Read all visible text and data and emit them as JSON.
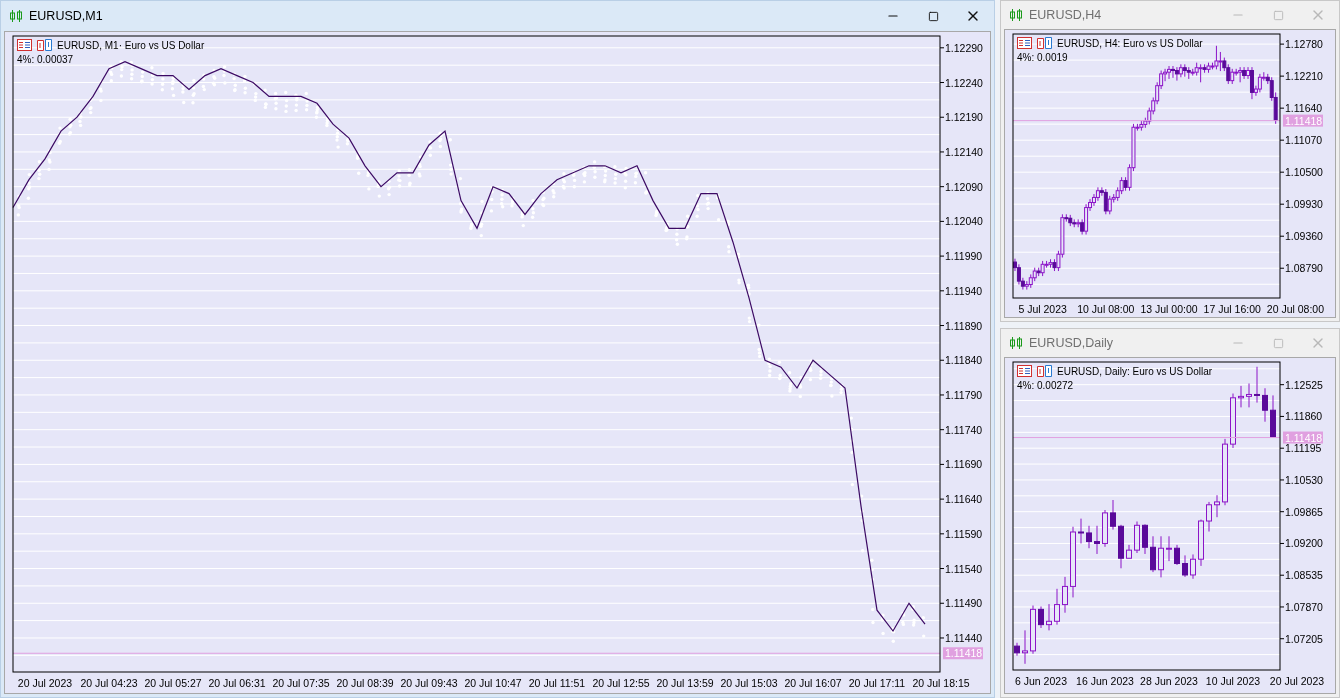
{
  "windows": [
    {
      "title": "EURUSD,M1",
      "active": true,
      "chart": {
        "symbol_label": "EURUSD, M1· Euro vs US Dollar",
        "scale_label": "4%: 0.00037",
        "chart_data": {
          "type": "line",
          "grid": true,
          "ylim": [
            1.11391,
            1.12307
          ],
          "categories": [
            null,
            null,
            "20 Jul 2023",
            null,
            null,
            null,
            "20 Jul 04:23",
            null,
            null,
            null,
            "20 Jul 05:27",
            null,
            null,
            null,
            "20 Jul 06:31",
            null,
            null,
            null,
            "20 Jul 07:35",
            null,
            null,
            null,
            "20 Jul 08:39",
            null,
            null,
            null,
            "20 Jul 09:43",
            null,
            null,
            null,
            "20 Jul 10:47",
            null,
            null,
            null,
            "20 Jul 11:51",
            null,
            null,
            null,
            "20 Jul 12:55",
            null,
            null,
            null,
            "20 Jul 13:59",
            null,
            null,
            null,
            "20 Jul 15:03",
            null,
            null,
            null,
            "20 Jul 16:07",
            null,
            null,
            null,
            "20 Jul 17:11",
            null,
            null,
            null,
            "20 Jul 18:15"
          ],
          "yticks": [
            {
              "value": 1.1229,
              "label": "1.12290"
            },
            {
              "value": 1.1224,
              "label": "1.12240"
            },
            {
              "value": 1.1219,
              "label": "1.12190"
            },
            {
              "value": 1.1214,
              "label": "1.12140"
            },
            {
              "value": 1.1209,
              "label": "1.12090"
            },
            {
              "value": 1.1204,
              "label": "1.12040"
            },
            {
              "value": 1.1199,
              "label": "1.11990"
            },
            {
              "value": 1.1194,
              "label": "1.11940"
            },
            {
              "value": 1.1189,
              "label": "1.11890"
            },
            {
              "value": 1.1184,
              "label": "1.11840"
            },
            {
              "value": 1.1179,
              "label": "1.11790"
            },
            {
              "value": 1.1174,
              "label": "1.11740"
            },
            {
              "value": 1.1169,
              "label": "1.11690"
            },
            {
              "value": 1.1164,
              "label": "1.11640"
            },
            {
              "value": 1.1159,
              "label": "1.11590"
            },
            {
              "value": 1.1154,
              "label": "1.11540"
            },
            {
              "value": 1.1149,
              "label": "1.11490"
            },
            {
              "value": 1.1144,
              "label": "1.11440"
            }
          ],
          "ref_lines": [
            {
              "axis": "y",
              "value": 1.11418,
              "label": "1.11418"
            }
          ],
          "series": [
            {
              "color": "#3c0a64",
              "values": [
                1.1206,
                1.121,
                1.1213,
                1.1217,
                1.1219,
                1.1222,
                1.1226,
                1.1227,
                1.1226,
                1.1225,
                1.1225,
                1.1223,
                1.1225,
                1.1226,
                1.1225,
                1.1224,
                1.1222,
                1.1222,
                1.1222,
                1.1221,
                1.1218,
                1.1216,
                1.1212,
                1.1209,
                1.1211,
                1.1211,
                1.1215,
                1.1217,
                1.1207,
                1.1203,
                1.1209,
                1.1208,
                1.1205,
                1.1208,
                1.121,
                1.1211,
                1.1212,
                1.1212,
                1.1211,
                1.1212,
                1.1207,
                1.1203,
                1.1203,
                1.1208,
                1.1208,
                1.1201,
                1.1193,
                1.1184,
                1.1183,
                1.118,
                1.1184,
                1.1182,
                1.118,
                1.1163,
                1.1148,
                1.1145,
                1.1149,
                1.1146,
                null
              ]
            }
          ]
        }
      }
    },
    {
      "title": "EURUSD,H4",
      "active": false,
      "chart": {
        "symbol_label": "EURUSD, H4:  Euro vs US Dollar",
        "scale_label": "4%: 0.0019",
        "chart_data": {
          "type": "candlestick",
          "grid": true,
          "ylim": [
            1.0826,
            1.1296
          ],
          "categories": [
            null,
            null,
            null,
            null,
            null,
            null,
            null,
            "5 Jul 2023",
            null,
            null,
            null,
            null,
            null,
            null,
            null,
            null,
            null,
            null,
            null,
            null,
            null,
            null,
            null,
            "10 Jul 08:00",
            null,
            null,
            null,
            null,
            null,
            null,
            null,
            null,
            null,
            null,
            null,
            null,
            null,
            null,
            null,
            "13 Jul 00:00",
            null,
            null,
            null,
            null,
            null,
            null,
            null,
            null,
            null,
            null,
            null,
            null,
            null,
            null,
            null,
            "17 Jul 16:00",
            null,
            null,
            null,
            null,
            null,
            null,
            null,
            null,
            null,
            null,
            null,
            null,
            null,
            null,
            null,
            "20 Jul 08:00"
          ],
          "yticks": [
            {
              "value": 1.1278,
              "label": "1.12780"
            },
            {
              "value": 1.1221,
              "label": "1.12210"
            },
            {
              "value": 1.1164,
              "label": "1.11640"
            },
            {
              "value": 1.1107,
              "label": "1.11070"
            },
            {
              "value": 1.105,
              "label": "1.10500"
            },
            {
              "value": 1.0993,
              "label": "1.09930"
            },
            {
              "value": 1.0936,
              "label": "1.09360"
            },
            {
              "value": 1.0879,
              "label": "1.08790"
            }
          ],
          "ref_lines": [
            {
              "axis": "y",
              "value": 1.11418,
              "label": "1.11418"
            }
          ],
          "ohlc": [
            [
              1.089,
              1.0896,
              1.0874,
              1.088
            ],
            [
              1.088,
              1.0886,
              1.085,
              1.0856
            ],
            [
              1.0856,
              1.0862,
              1.0841,
              1.0847
            ],
            [
              1.0847,
              1.0856,
              1.0841,
              1.085
            ],
            [
              1.085,
              1.0868,
              1.0844,
              1.0862
            ],
            [
              1.0862,
              1.088,
              1.0856,
              1.0874
            ],
            [
              1.0874,
              1.088,
              1.0865,
              1.0871
            ],
            [
              1.0871,
              1.0892,
              1.0865,
              1.0886
            ],
            [
              1.0886,
              1.0892,
              1.088,
              1.0886
            ],
            [
              1.0886,
              1.0895,
              1.088,
              1.0889
            ],
            [
              1.0889,
              1.0895,
              1.0874,
              1.088
            ],
            [
              1.088,
              1.091,
              1.0874,
              1.0904
            ],
            [
              1.0904,
              1.0975,
              1.0898,
              1.0969
            ],
            [
              1.0969,
              1.0975,
              1.0962,
              1.0968
            ],
            [
              1.0968,
              1.0974,
              1.0954,
              1.096
            ],
            [
              1.096,
              1.0966,
              1.0952,
              1.0958
            ],
            [
              1.0958,
              1.0966,
              1.0952,
              1.096
            ],
            [
              1.096,
              1.0966,
              1.0939,
              1.0945
            ],
            [
              1.0945,
              1.0993,
              1.0939,
              1.0987
            ],
            [
              1.0987,
              1.1002,
              1.0981,
              1.0996
            ],
            [
              1.0996,
              1.1011,
              1.099,
              1.1005
            ],
            [
              1.1005,
              1.1023,
              1.0999,
              1.1017
            ],
            [
              1.1017,
              1.1023,
              1.1008,
              1.1014
            ],
            [
              1.1014,
              1.102,
              1.0975,
              1.0981
            ],
            [
              1.0981,
              1.1008,
              1.0975,
              1.1002
            ],
            [
              1.1002,
              1.1011,
              1.0996,
              1.1005
            ],
            [
              1.1005,
              1.1023,
              1.0999,
              1.1017
            ],
            [
              1.1017,
              1.1041,
              1.1011,
              1.1035
            ],
            [
              1.1035,
              1.1041,
              1.1017,
              1.1023
            ],
            [
              1.1023,
              1.1064,
              1.1017,
              1.1058
            ],
            [
              1.1058,
              1.1136,
              1.1052,
              1.113
            ],
            [
              1.113,
              1.1136,
              1.1124,
              1.113
            ],
            [
              1.113,
              1.1141,
              1.1124,
              1.1135
            ],
            [
              1.1135,
              1.1147,
              1.1129,
              1.1141
            ],
            [
              1.1141,
              1.1165,
              1.1135,
              1.1159
            ],
            [
              1.1159,
              1.1183,
              1.1153,
              1.1177
            ],
            [
              1.1177,
              1.121,
              1.1171,
              1.1204
            ],
            [
              1.1204,
              1.1231,
              1.1198,
              1.1225
            ],
            [
              1.1225,
              1.1234,
              1.1212,
              1.1228
            ],
            [
              1.1228,
              1.1239,
              1.1216,
              1.1233
            ],
            [
              1.1233,
              1.1239,
              1.1218,
              1.1231
            ],
            [
              1.1231,
              1.1237,
              1.1213,
              1.1225
            ],
            [
              1.1225,
              1.1242,
              1.1219,
              1.1236
            ],
            [
              1.1236,
              1.1242,
              1.122,
              1.1231
            ],
            [
              1.1231,
              1.1237,
              1.1216,
              1.1228
            ],
            [
              1.1228,
              1.1234,
              1.1222,
              1.1228
            ],
            [
              1.1228,
              1.1245,
              1.1222,
              1.1236
            ],
            [
              1.1236,
              1.1242,
              1.121,
              1.1236
            ],
            [
              1.1236,
              1.1242,
              1.1227,
              1.1233
            ],
            [
              1.1233,
              1.1245,
              1.1227,
              1.1239
            ],
            [
              1.1239,
              1.1245,
              1.1233,
              1.1239
            ],
            [
              1.1239,
              1.1275,
              1.1233,
              1.1248
            ],
            [
              1.1248,
              1.1264,
              1.123,
              1.1248
            ],
            [
              1.1248,
              1.1254,
              1.123,
              1.1236
            ],
            [
              1.1236,
              1.1242,
              1.1207,
              1.1213
            ],
            [
              1.1213,
              1.1234,
              1.1207,
              1.1228
            ],
            [
              1.1228,
              1.1234,
              1.1222,
              1.1228
            ],
            [
              1.1228,
              1.1237,
              1.121,
              1.1231
            ],
            [
              1.1231,
              1.1237,
              1.1216,
              1.1222
            ],
            [
              1.1222,
              1.1237,
              1.1216,
              1.1231
            ],
            [
              1.1231,
              1.1237,
              1.118,
              1.1192
            ],
            [
              1.1192,
              1.1204,
              1.1186,
              1.1198
            ],
            [
              1.1198,
              1.1225,
              1.1192,
              1.1219
            ],
            [
              1.1219,
              1.1228,
              1.1213,
              1.1219
            ],
            [
              1.1219,
              1.1225,
              1.1207,
              1.1213
            ],
            [
              1.1213,
              1.1219,
              1.1177,
              1.1183
            ],
            [
              1.1183,
              1.1192,
              1.1136,
              1.1142
            ],
            null,
            null,
            null,
            null,
            null
          ]
        }
      }
    },
    {
      "title": "EURUSD,Daily",
      "active": false,
      "chart": {
        "symbol_label": "EURUSD, Daily:  Euro vs US Dollar",
        "scale_label": "4%: 0.00272",
        "chart_data": {
          "type": "candlestick",
          "grid": true,
          "ylim": [
            1.0655,
            1.13
          ],
          "categories": [
            null,
            null,
            null,
            "6 Jun 2023",
            null,
            null,
            null,
            null,
            null,
            null,
            null,
            "16 Jun 2023",
            null,
            null,
            null,
            null,
            null,
            null,
            null,
            "28 Jun 2023",
            null,
            null,
            null,
            null,
            null,
            null,
            null,
            "10 Jul 2023",
            null,
            null,
            null,
            null,
            null,
            null,
            null,
            "20 Jul 2023"
          ],
          "yticks": [
            {
              "value": 1.12525,
              "label": "1.12525"
            },
            {
              "value": 1.1186,
              "label": "1.11860"
            },
            {
              "value": 1.11195,
              "label": "1.11195"
            },
            {
              "value": 1.1053,
              "label": "1.10530"
            },
            {
              "value": 1.09865,
              "label": "1.09865"
            },
            {
              "value": 1.092,
              "label": "1.09200"
            },
            {
              "value": 1.08535,
              "label": "1.08535"
            },
            {
              "value": 1.0787,
              "label": "1.07870"
            },
            {
              "value": 1.07205,
              "label": "1.07205"
            }
          ],
          "ref_lines": [
            {
              "axis": "y",
              "value": 1.11418,
              "label": "1.11418"
            }
          ],
          "ohlc": [
            [
              1.0705,
              1.0712,
              1.0685,
              1.0691
            ],
            [
              1.0691,
              1.0738,
              1.0668,
              1.0695
            ],
            [
              1.0695,
              1.079,
              1.0689,
              1.0782
            ],
            [
              1.0782,
              1.0788,
              1.0743,
              1.075
            ],
            [
              1.075,
              1.0793,
              1.0738,
              1.0757
            ],
            [
              1.0757,
              1.0825,
              1.075,
              1.0792
            ],
            [
              1.0792,
              1.085,
              1.0775,
              1.083
            ],
            [
              1.083,
              1.0955,
              1.0807,
              1.0944
            ],
            [
              1.0944,
              1.0972,
              1.092,
              1.0942
            ],
            [
              1.0942,
              1.0957,
              1.091,
              1.0924
            ],
            [
              1.0924,
              1.0957,
              1.0898,
              1.092
            ],
            [
              1.092,
              1.099,
              1.0913,
              1.0984
            ],
            [
              1.0984,
              1.1011,
              1.0949,
              1.0956
            ],
            [
              1.0956,
              1.0959,
              1.0868,
              1.0889
            ],
            [
              1.0889,
              1.0917,
              1.0889,
              1.0906
            ],
            [
              1.0906,
              1.0966,
              1.09,
              1.0958
            ],
            [
              1.0958,
              1.096,
              1.0898,
              1.0912
            ],
            [
              1.0912,
              1.0935,
              1.086,
              1.0865
            ],
            [
              1.0865,
              1.0935,
              1.0849,
              1.091
            ],
            [
              1.091,
              1.0935,
              1.0883,
              1.091
            ],
            [
              1.091,
              1.0917,
              1.0875,
              1.0878
            ],
            [
              1.0878,
              1.0895,
              1.085,
              1.0854
            ],
            [
              1.0854,
              1.0897,
              1.0846,
              1.0887
            ],
            [
              1.0887,
              1.097,
              1.0873,
              1.0967
            ],
            [
              1.0967,
              1.1007,
              1.0945,
              1.1001
            ],
            [
              1.1001,
              1.1021,
              1.0975,
              1.1007
            ],
            [
              1.1007,
              1.1139,
              1.1,
              1.1128
            ],
            [
              1.1128,
              1.1234,
              1.112,
              1.1225
            ],
            [
              1.1225,
              1.125,
              1.1205,
              1.1228
            ],
            [
              1.1228,
              1.1255,
              1.1205,
              1.1232
            ],
            [
              1.1232,
              1.129,
              1.1215,
              1.123
            ],
            [
              1.123,
              1.1245,
              1.1175,
              1.1199
            ],
            [
              1.1199,
              1.123,
              1.1142,
              1.1142
            ],
            null,
            null,
            null
          ]
        }
      }
    }
  ]
}
